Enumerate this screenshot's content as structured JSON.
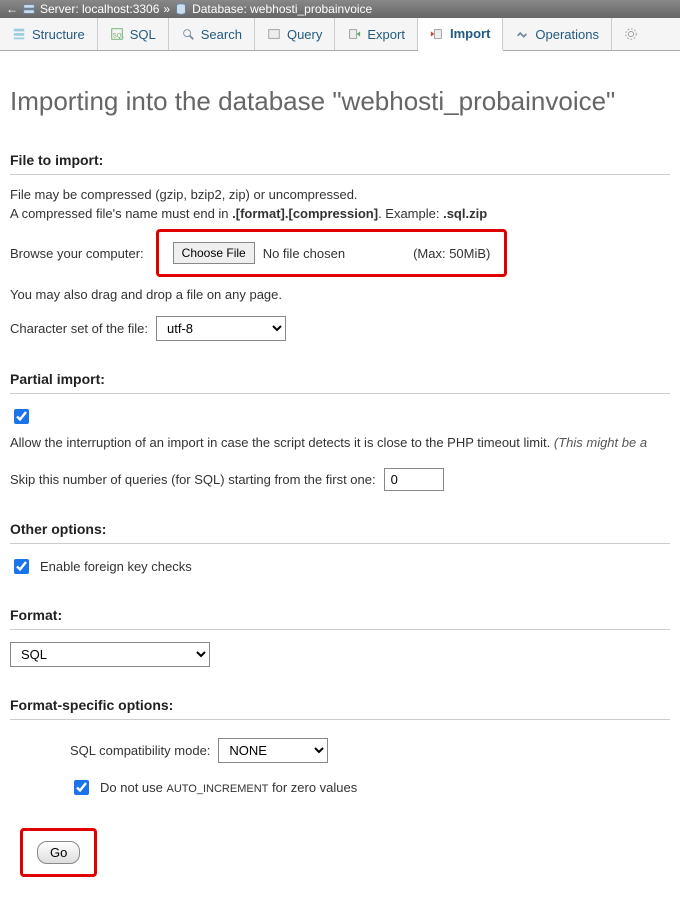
{
  "breadcrumb": {
    "server_label": "Server: localhost:3306",
    "separator": "»",
    "database_label": "Database: webhosti_probainvoice"
  },
  "tabs": {
    "structure": "Structure",
    "sql": "SQL",
    "search": "Search",
    "query": "Query",
    "export": "Export",
    "import": "Import",
    "operations": "Operations"
  },
  "title": "Importing into the database \"webhosti_probainvoice\"",
  "file_section": {
    "heading": "File to import:",
    "help1": "File may be compressed (gzip, bzip2, zip) or uncompressed.",
    "help2_prefix": "A compressed file's name must end in ",
    "help2_format": ".[format].[compression]",
    "help2_example_label": ". Example: ",
    "help2_example": ".sql.zip",
    "browse_label": "Browse your computer:",
    "choose_file_btn": "Choose File",
    "no_file": "No file chosen",
    "max_label": "(Max: 50MiB)",
    "drag_hint": "You may also drag and drop a file on any page.",
    "charset_label": "Character set of the file:",
    "charset_value": "utf-8"
  },
  "partial": {
    "heading": "Partial import:",
    "allow_label_main": "Allow the interruption of an import in case the script detects it is close to the PHP timeout limit.",
    "allow_label_italic": "(This might be a",
    "skip_label": "Skip this number of queries (for SQL) starting from the first one:",
    "skip_value": "0"
  },
  "other": {
    "heading": "Other options:",
    "fk_label": "Enable foreign key checks"
  },
  "format": {
    "heading": "Format:",
    "value": "SQL"
  },
  "fso": {
    "heading": "Format-specific options:",
    "compat_label": "SQL compatibility mode:",
    "compat_value": "NONE",
    "autoinc_prefix": "Do not use ",
    "autoinc_code": "AUTO_INCREMENT",
    "autoinc_suffix": " for zero values"
  },
  "go_label": "Go"
}
